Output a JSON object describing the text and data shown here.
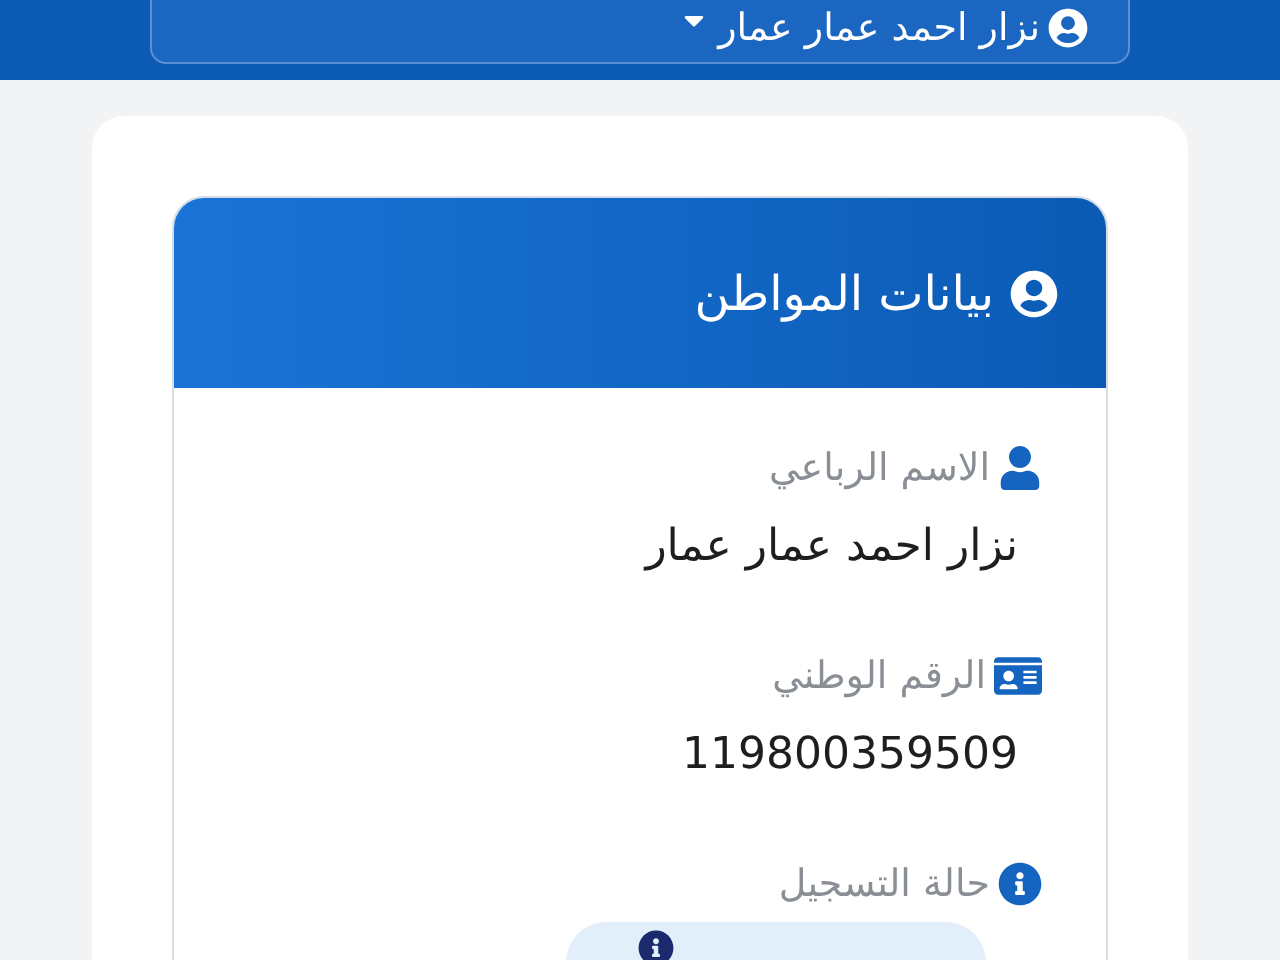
{
  "user_menu": {
    "label": "نزار احمد عمار عمار"
  },
  "card": {
    "title": "بيانات المواطن"
  },
  "fields": [
    {
      "kind": "person",
      "label": "الاسم الرباعي",
      "value": "نزار احمد عمار عمار"
    },
    {
      "kind": "id",
      "label": "الرقم الوطني",
      "value": "119800359509"
    },
    {
      "kind": "info",
      "label": "حالة التسجيل"
    }
  ]
}
